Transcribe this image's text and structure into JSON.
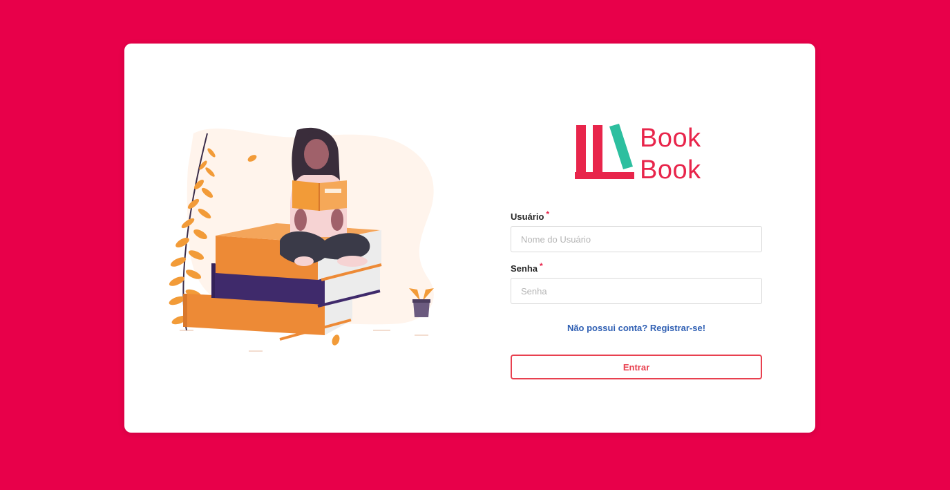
{
  "brand": {
    "name_line1": "Book",
    "name_line2": "Book",
    "color": "#e8254b",
    "accent": "#2dbf9f"
  },
  "background_color": "#e8004a",
  "illustration": {
    "subject": "person-reading-on-book-stack"
  },
  "form": {
    "username": {
      "label": "Usuário",
      "required_mark": "*",
      "placeholder": "Nome do Usuário",
      "value": ""
    },
    "password": {
      "label": "Senha",
      "required_mark": "*",
      "placeholder": "Senha",
      "value": ""
    },
    "register_link": "Não possui conta? Registrar-se!",
    "submit_label": "Entrar"
  }
}
